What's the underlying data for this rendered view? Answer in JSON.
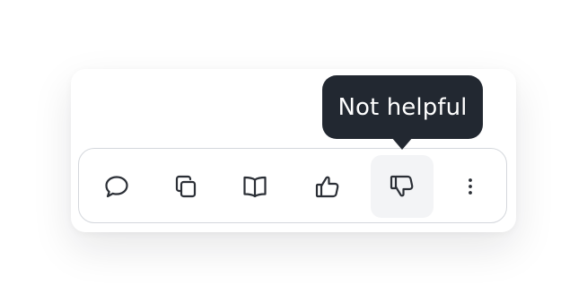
{
  "tooltip": {
    "text": "Not helpful"
  },
  "toolbar": {
    "buttons": [
      {
        "name": "comment",
        "icon": "speech-bubble-icon"
      },
      {
        "name": "copy",
        "icon": "copy-icon"
      },
      {
        "name": "read",
        "icon": "open-book-icon"
      },
      {
        "name": "helpful",
        "icon": "thumbs-up-icon"
      },
      {
        "name": "not-helpful",
        "icon": "thumbs-down-icon",
        "state": "hovered"
      },
      {
        "name": "more",
        "icon": "vertical-ellipsis-icon"
      }
    ]
  },
  "colors": {
    "icon": "#2b2f36",
    "tooltip_bg": "#222831",
    "toolbar_border": "#d4d7dc",
    "active_button_bg": "#f3f4f6"
  }
}
